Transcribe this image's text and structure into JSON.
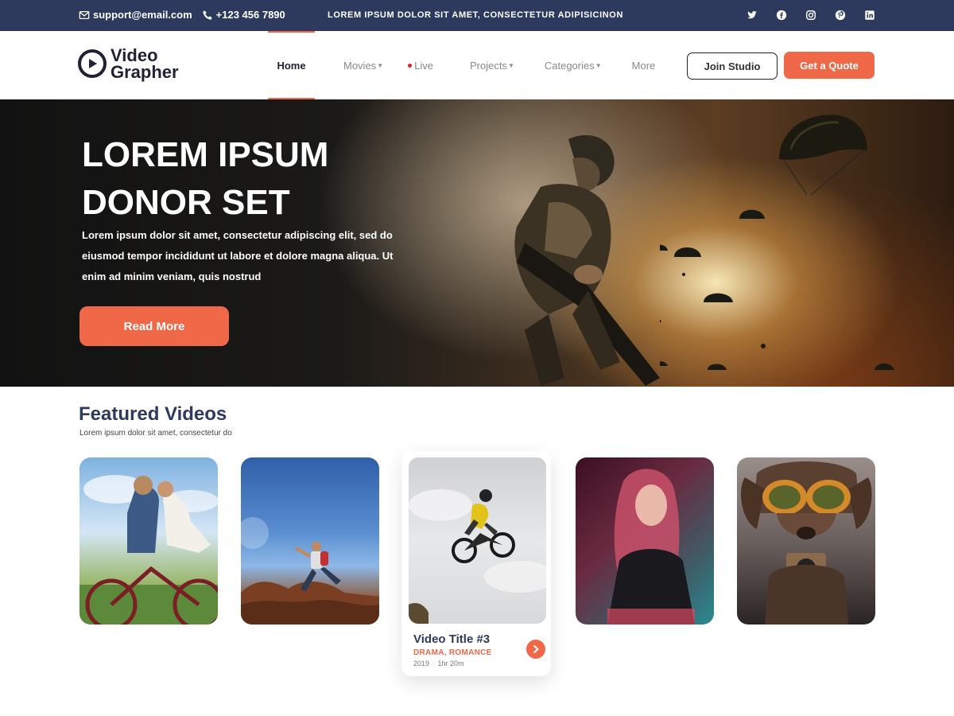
{
  "topbar": {
    "email": "support@email.com",
    "phone": "+123 456 7890",
    "tagline": "LOREM IPSUM DOLOR SIT AMET, CONSECTETUR ADIPISICINON",
    "social_icons": [
      "twitter-icon",
      "facebook-icon",
      "instagram-icon",
      "pinterest-icon",
      "linkedin-icon"
    ]
  },
  "brand": {
    "line1": "Video",
    "line2": "Grapher"
  },
  "nav": {
    "items": [
      {
        "label": "Home",
        "active": true,
        "dropdown": false
      },
      {
        "label": "Movies",
        "active": false,
        "dropdown": true
      },
      {
        "label": "Live",
        "active": false,
        "dropdown": false,
        "live": true
      },
      {
        "label": "Projects",
        "active": false,
        "dropdown": true
      },
      {
        "label": "Categories",
        "active": false,
        "dropdown": true
      },
      {
        "label": "More",
        "active": false,
        "dropdown": false
      }
    ],
    "join_label": "Join Studio",
    "quote_label": "Get a Quote"
  },
  "hero": {
    "title_line1": "LOREM IPSUM",
    "title_line2": "DONOR SET",
    "text": "Lorem ipsum dolor sit amet, consectetur adipiscing elit, sed do eiusmod tempor incididunt ut labore et dolore magna aliqua. Ut enim ad minim veniam, quis nostrud",
    "button_label": "Read More"
  },
  "featured": {
    "title": "Featured Videos",
    "subtitle": "Lorem ipsum dolor sit amet, consectetur  do",
    "active_card": {
      "title": "Video Title #3",
      "genre": "DRAMA, ROMANCE",
      "year": "2019",
      "duration": "1hr 20m"
    }
  },
  "colors": {
    "accent": "#ef6848",
    "navy": "#2d3a5e",
    "topbar": "#2d3a5e"
  }
}
